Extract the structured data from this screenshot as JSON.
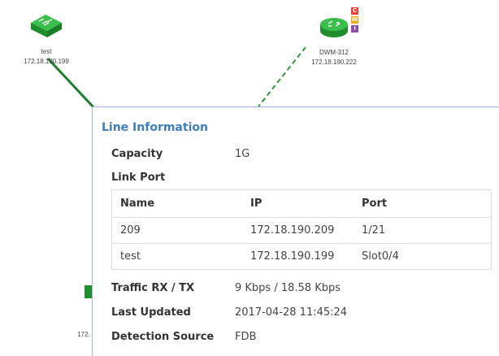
{
  "topology": {
    "nodes": [
      {
        "name": "test",
        "ip": "172.18.190.199",
        "icon": "switch-icon"
      },
      {
        "name": "DWM-312",
        "ip": "172.18.190.222",
        "icon": "router-icon",
        "badges": [
          "C",
          "W",
          "I"
        ]
      },
      {
        "name": "",
        "ip": "172."
      }
    ],
    "colors": {
      "link_solid": "#1e7f2e",
      "link_dashed": "#2e9b3b",
      "device": "#26a23a",
      "badge_c": "#e8413a",
      "badge_w": "#f0a91c",
      "badge_i": "#8a4aa8"
    }
  },
  "panel": {
    "title": "Line Information",
    "capacity_label": "Capacity",
    "capacity_value": "1G",
    "link_port_label": "Link Port",
    "table": {
      "headers": [
        "Name",
        "IP",
        "Port"
      ],
      "rows": [
        [
          "209",
          "172.18.190.209",
          "1/21"
        ],
        [
          "test",
          "172.18.190.199",
          "Slot0/4"
        ]
      ]
    },
    "traffic_label": "Traffic RX / TX",
    "traffic_value": "9 Kbps / 18.58 Kbps",
    "updated_label": "Last Updated",
    "updated_value": "2017-04-28 11:45:24",
    "source_label": "Detection Source",
    "source_value": "FDB"
  }
}
